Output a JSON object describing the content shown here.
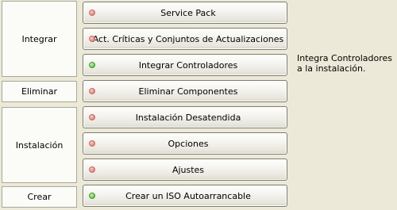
{
  "groups": {
    "integrar": "Integrar",
    "eliminar": "Eliminar",
    "instalacion": "Instalación",
    "crear": "Crear"
  },
  "buttons": [
    {
      "label": "Service Pack",
      "status": "red"
    },
    {
      "label": "Act. Críticas y Conjuntos de Actualizaciones",
      "status": "red"
    },
    {
      "label": "Integrar Controladores",
      "status": "green"
    },
    {
      "label": "Eliminar Componentes",
      "status": "red"
    },
    {
      "label": "Instalación Desatendida",
      "status": "red"
    },
    {
      "label": "Opciones",
      "status": "red"
    },
    {
      "label": "Ajustes",
      "status": "red"
    },
    {
      "label": "Crear un ISO Autoarrancable",
      "status": "green"
    }
  ],
  "description": "Integra Controladores a la instalación.",
  "colors": {
    "background": "#ece9d8",
    "status_red": "#e4817a",
    "status_green": "#6cc24f"
  }
}
